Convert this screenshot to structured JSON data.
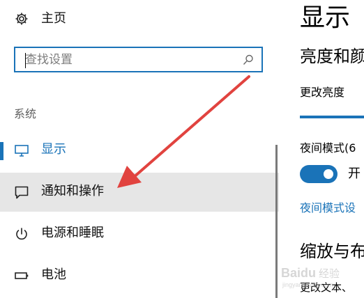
{
  "sidebar": {
    "home": {
      "label": "主页",
      "icon": "gear-icon"
    },
    "search": {
      "placeholder": "查找设置",
      "value": "",
      "icon": "search-icon"
    },
    "section_title": "系统",
    "items": [
      {
        "label": "显示",
        "icon": "monitor-icon",
        "selected": true
      },
      {
        "label": "通知和操作",
        "icon": "notification-icon",
        "hovered": true
      },
      {
        "label": "电源和睡眠",
        "icon": "power-icon"
      },
      {
        "label": "电池",
        "icon": "battery-icon"
      }
    ]
  },
  "content": {
    "title": "显示",
    "brightness_heading": "亮度和颜",
    "brightness_label": "更改亮度",
    "night_mode_label": "夜间模式(6",
    "night_mode_toggle": {
      "on": true,
      "text": "开"
    },
    "night_mode_link": "夜间模式设",
    "scale_heading": "缩放与布",
    "scale_text": "更改文本、"
  },
  "watermark": {
    "text": "Baidu经验",
    "domain": "jingyan.baidu.com"
  },
  "colors": {
    "accent": "#1a73b8",
    "hover_bg": "#e6e6e6",
    "arrow": "#e1433f",
    "section_text": "#5f5f5f"
  }
}
